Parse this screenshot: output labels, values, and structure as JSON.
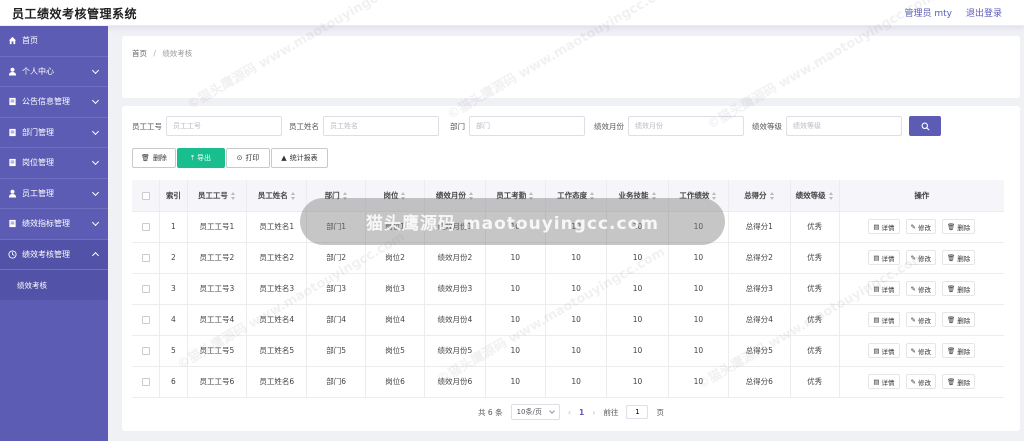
{
  "header": {
    "title": "员工绩效考核管理系统",
    "user": "管理员 mty",
    "logout": "退出登录"
  },
  "sidebar": {
    "items": [
      {
        "label": "首页",
        "icon": "home-icon",
        "chevron": false
      },
      {
        "label": "个人中心",
        "icon": "user-icon",
        "chevron": true
      },
      {
        "label": "公告信息管理",
        "icon": "doc-icon",
        "chevron": true
      },
      {
        "label": "部门管理",
        "icon": "doc-icon",
        "chevron": true
      },
      {
        "label": "岗位管理",
        "icon": "doc-icon",
        "chevron": true
      },
      {
        "label": "员工管理",
        "icon": "user-icon",
        "chevron": true
      },
      {
        "label": "绩效指标管理",
        "icon": "doc-icon",
        "chevron": true
      },
      {
        "label": "绩效考核管理",
        "icon": "clock-icon",
        "chevron": true
      }
    ],
    "sub_item": "绩效考核"
  },
  "breadcrumb": {
    "home": "首页",
    "sep": "/",
    "current": "绩效考核"
  },
  "search": {
    "fields": [
      {
        "label": "员工工号",
        "placeholder": "员工工号"
      },
      {
        "label": "员工姓名",
        "placeholder": "员工姓名"
      },
      {
        "label": "部门",
        "placeholder": "部门"
      },
      {
        "label": "绩效月份",
        "placeholder": "绩效月份"
      },
      {
        "label": "绩效等级",
        "placeholder": "绩效等级"
      }
    ]
  },
  "toolbar": {
    "delete": "删除",
    "export": "导出",
    "print": "打印",
    "report": "统计报表"
  },
  "table": {
    "headers": [
      "索引",
      "员工工号",
      "员工姓名",
      "部门",
      "岗位",
      "绩效月份",
      "员工考勤",
      "工作态度",
      "业务技能",
      "工作绩效",
      "总得分",
      "绩效等级",
      "操作"
    ],
    "rows": [
      [
        "1",
        "员工工号1",
        "员工姓名1",
        "部门1",
        "岗位1",
        "绩效月份1",
        "10",
        "10",
        "10",
        "10",
        "总得分1",
        "优秀"
      ],
      [
        "2",
        "员工工号2",
        "员工姓名2",
        "部门2",
        "岗位2",
        "绩效月份2",
        "10",
        "10",
        "10",
        "10",
        "总得分2",
        "优秀"
      ],
      [
        "3",
        "员工工号3",
        "员工姓名3",
        "部门3",
        "岗位3",
        "绩效月份3",
        "10",
        "10",
        "10",
        "10",
        "总得分3",
        "优秀"
      ],
      [
        "4",
        "员工工号4",
        "员工姓名4",
        "部门4",
        "岗位4",
        "绩效月份4",
        "10",
        "10",
        "10",
        "10",
        "总得分4",
        "优秀"
      ],
      [
        "5",
        "员工工号5",
        "员工姓名5",
        "部门5",
        "岗位5",
        "绩效月份5",
        "10",
        "10",
        "10",
        "10",
        "总得分5",
        "优秀"
      ],
      [
        "6",
        "员工工号6",
        "员工姓名6",
        "部门6",
        "岗位6",
        "绩效月份6",
        "10",
        "10",
        "10",
        "10",
        "总得分6",
        "优秀"
      ]
    ],
    "ops": {
      "detail": "详情",
      "edit": "修改",
      "delete": "删除"
    }
  },
  "pagination": {
    "total": "共 6 条",
    "page_size": "10条/页",
    "current_page": "1",
    "goto_label": "前往",
    "goto_value": "1",
    "page_suffix": "页"
  },
  "watermark": {
    "banner": "猫头鹰源码 maotouyingcc.com",
    "diag": "©猫头鹰源码 www.maotouyingcc.com"
  },
  "colors": {
    "primary": "#5c5cb4",
    "export_green": "#19be8f"
  }
}
